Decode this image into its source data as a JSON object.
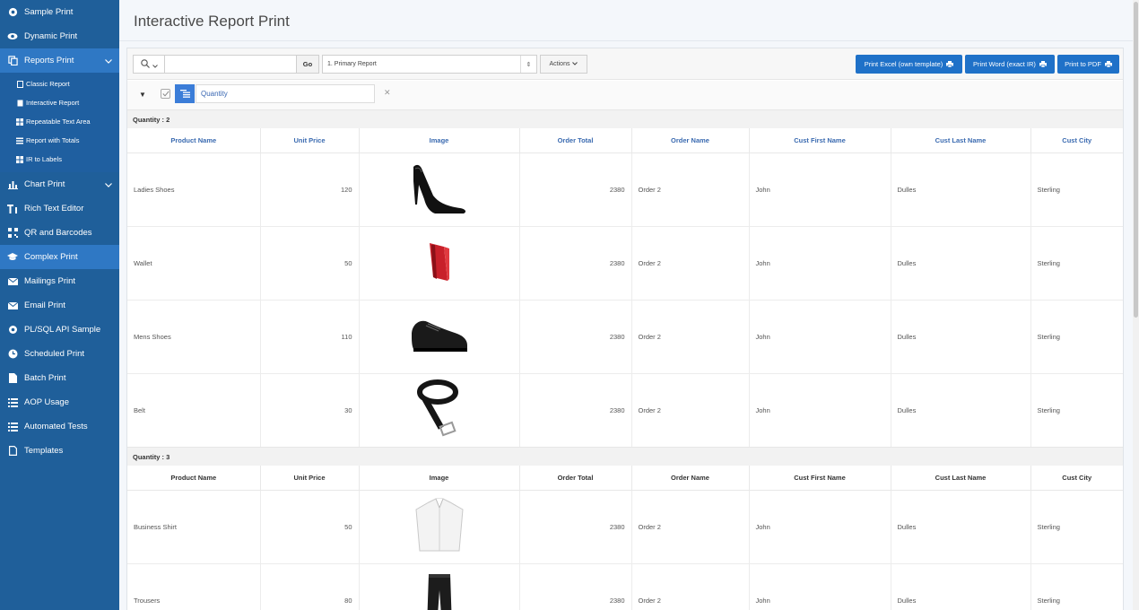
{
  "app": {
    "title": "Interactive Report Print"
  },
  "sidebar": {
    "items": [
      {
        "label": "Sample Print",
        "icon": "sun-icon"
      },
      {
        "label": "Dynamic Print",
        "icon": "eye-icon"
      },
      {
        "label": "Reports Print",
        "icon": "copy-icon",
        "expanded": true
      },
      {
        "label": "Chart Print",
        "icon": "bar-chart-icon",
        "expandable": true
      },
      {
        "label": "Rich Text Editor",
        "icon": "text-icon"
      },
      {
        "label": "QR and Barcodes",
        "icon": "qr-icon"
      },
      {
        "label": "Complex Print",
        "icon": "graduation-cap-icon",
        "selected": true
      },
      {
        "label": "Mailings Print",
        "icon": "envelope-icon"
      },
      {
        "label": "Email Print",
        "icon": "envelope-icon"
      },
      {
        "label": "PL/SQL API Sample",
        "icon": "gear-icon"
      },
      {
        "label": "Scheduled Print",
        "icon": "clock-icon"
      },
      {
        "label": "Batch Print",
        "icon": "file-icon"
      },
      {
        "label": "AOP Usage",
        "icon": "list-icon"
      },
      {
        "label": "Automated Tests",
        "icon": "list-icon"
      },
      {
        "label": "Templates",
        "icon": "file-icon"
      }
    ],
    "subitems": [
      {
        "label": "Classic Report",
        "icon": "doc-icon"
      },
      {
        "label": "Interactive Report",
        "icon": "doc-icon"
      },
      {
        "label": "Repeatable Text Area",
        "icon": "grid-icon"
      },
      {
        "label": "Report with Totals",
        "icon": "list-icon"
      },
      {
        "label": "IR to Labels",
        "icon": "grid-icon"
      }
    ]
  },
  "toolbar": {
    "search_value": "",
    "go_label": "Go",
    "report_label": "1. Primary Report",
    "actions_label": "Actions",
    "print_excel_label": "Print Excel (own template)",
    "print_word_label": "Print Word (exact IR)",
    "print_pdf_label": "Print to PDF",
    "accent": "#1f71c8"
  },
  "filter": {
    "label": "Quantity"
  },
  "columns": [
    "Product Name",
    "Unit Price",
    "Image",
    "Order Total",
    "Order Name",
    "Cust First Name",
    "Cust Last Name",
    "Cust City"
  ],
  "groups": [
    {
      "label": "Quantity : 2",
      "rows": [
        {
          "product": "Ladies Shoes",
          "price": "120",
          "image": "heel-image",
          "total": "2380",
          "order": "Order 2",
          "first": "John",
          "last": "Dulles",
          "city": "Sterling"
        },
        {
          "product": "Wallet",
          "price": "50",
          "image": "wallet-image",
          "total": "2380",
          "order": "Order 2",
          "first": "John",
          "last": "Dulles",
          "city": "Sterling"
        },
        {
          "product": "Mens Shoes",
          "price": "110",
          "image": "oxford-shoe-image",
          "total": "2380",
          "order": "Order 2",
          "first": "John",
          "last": "Dulles",
          "city": "Sterling"
        },
        {
          "product": "Belt",
          "price": "30",
          "image": "belt-image",
          "total": "2380",
          "order": "Order 2",
          "first": "John",
          "last": "Dulles",
          "city": "Sterling"
        }
      ]
    },
    {
      "label": "Quantity : 3",
      "rows": [
        {
          "product": "Business Shirt",
          "price": "50",
          "image": "shirt-image",
          "total": "2380",
          "order": "Order 2",
          "first": "John",
          "last": "Dulles",
          "city": "Sterling"
        },
        {
          "product": "Trousers",
          "price": "80",
          "image": "trousers-image",
          "total": "2380",
          "order": "Order 2",
          "first": "John",
          "last": "Dulles",
          "city": "Sterling"
        }
      ]
    }
  ]
}
